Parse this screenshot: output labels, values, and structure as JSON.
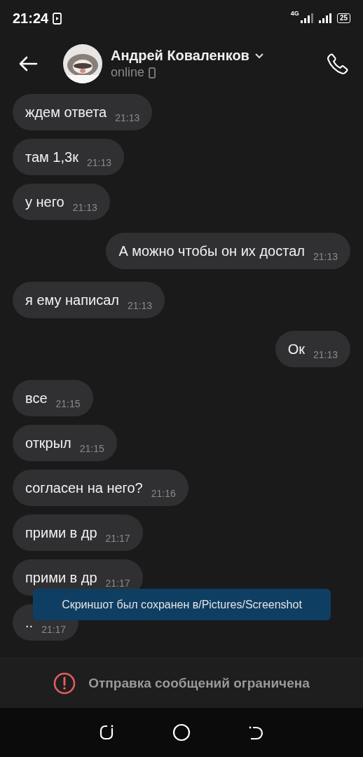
{
  "status_bar": {
    "time": "21:24",
    "network": "4G",
    "battery": "25"
  },
  "header": {
    "name": "Андрей Коваленков",
    "status": "online"
  },
  "messages": [
    {
      "outgoing": false,
      "text": "ждем ответа",
      "time": "21:13"
    },
    {
      "outgoing": false,
      "text": "там 1,3к",
      "time": "21:13"
    },
    {
      "outgoing": false,
      "text": "у него",
      "time": "21:13"
    },
    {
      "outgoing": true,
      "text": "А можно чтобы он их достал",
      "time": "21:13"
    },
    {
      "outgoing": false,
      "text": "я ему написал",
      "time": "21:13"
    },
    {
      "outgoing": true,
      "text": "Ок",
      "time": "21:13"
    },
    {
      "outgoing": false,
      "text": "все",
      "time": "21:15"
    },
    {
      "outgoing": false,
      "text": "открыл",
      "time": "21:15"
    },
    {
      "outgoing": false,
      "text": "согласен на него?",
      "time": "21:16"
    },
    {
      "outgoing": false,
      "text": "прими в др",
      "time": "21:17"
    },
    {
      "outgoing": false,
      "text": "прими в др",
      "time": "21:17"
    },
    {
      "outgoing": false,
      "text": "..",
      "time": "21:17"
    }
  ],
  "toast": "Скриншот был сохранен в/Pictures/Screenshot",
  "notice": "Отправка сообщений ограничена"
}
